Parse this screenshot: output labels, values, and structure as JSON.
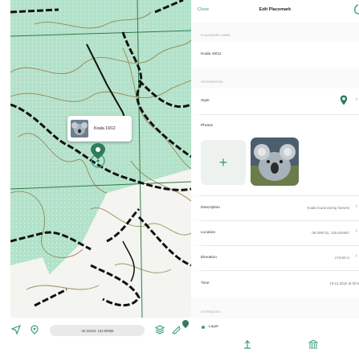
{
  "map": {
    "callout_title": "Koala 19/12",
    "coordinates": "-34.31810, 152.80556",
    "icons": [
      "navigate-arrow-icon",
      "location-pin-icon",
      "layers-icon",
      "ruler-icon",
      "pin-marker-icon"
    ]
  },
  "navbar": {
    "close_label": "Close",
    "title": "Edit Placemark",
    "save_icon": "save-icon"
  },
  "form": {
    "name_section": "Placemark name",
    "name_value": "Koala 19/12",
    "info_section": "Information",
    "style_label": "Style",
    "photos_label": "Photos",
    "add_photo_symbol": "+",
    "description_label": "Description",
    "description_value": "Koala found during harvest",
    "location_label": "Location",
    "location_value": "-38.299722, 146.634657",
    "elevation_label": "Elevation",
    "elevation_value": "173.90 m",
    "time_label": "Time",
    "time_value": "19.12.2022 at 05:5",
    "attributes_section": "Attributes",
    "layer_label": "Layer"
  },
  "colors": {
    "accent": "#3a9d78",
    "map_green": "#b2e2ca",
    "contour": "#8c7a3c"
  },
  "tabbar": {
    "icons": [
      "geotag-icon",
      "museum-icon"
    ]
  }
}
